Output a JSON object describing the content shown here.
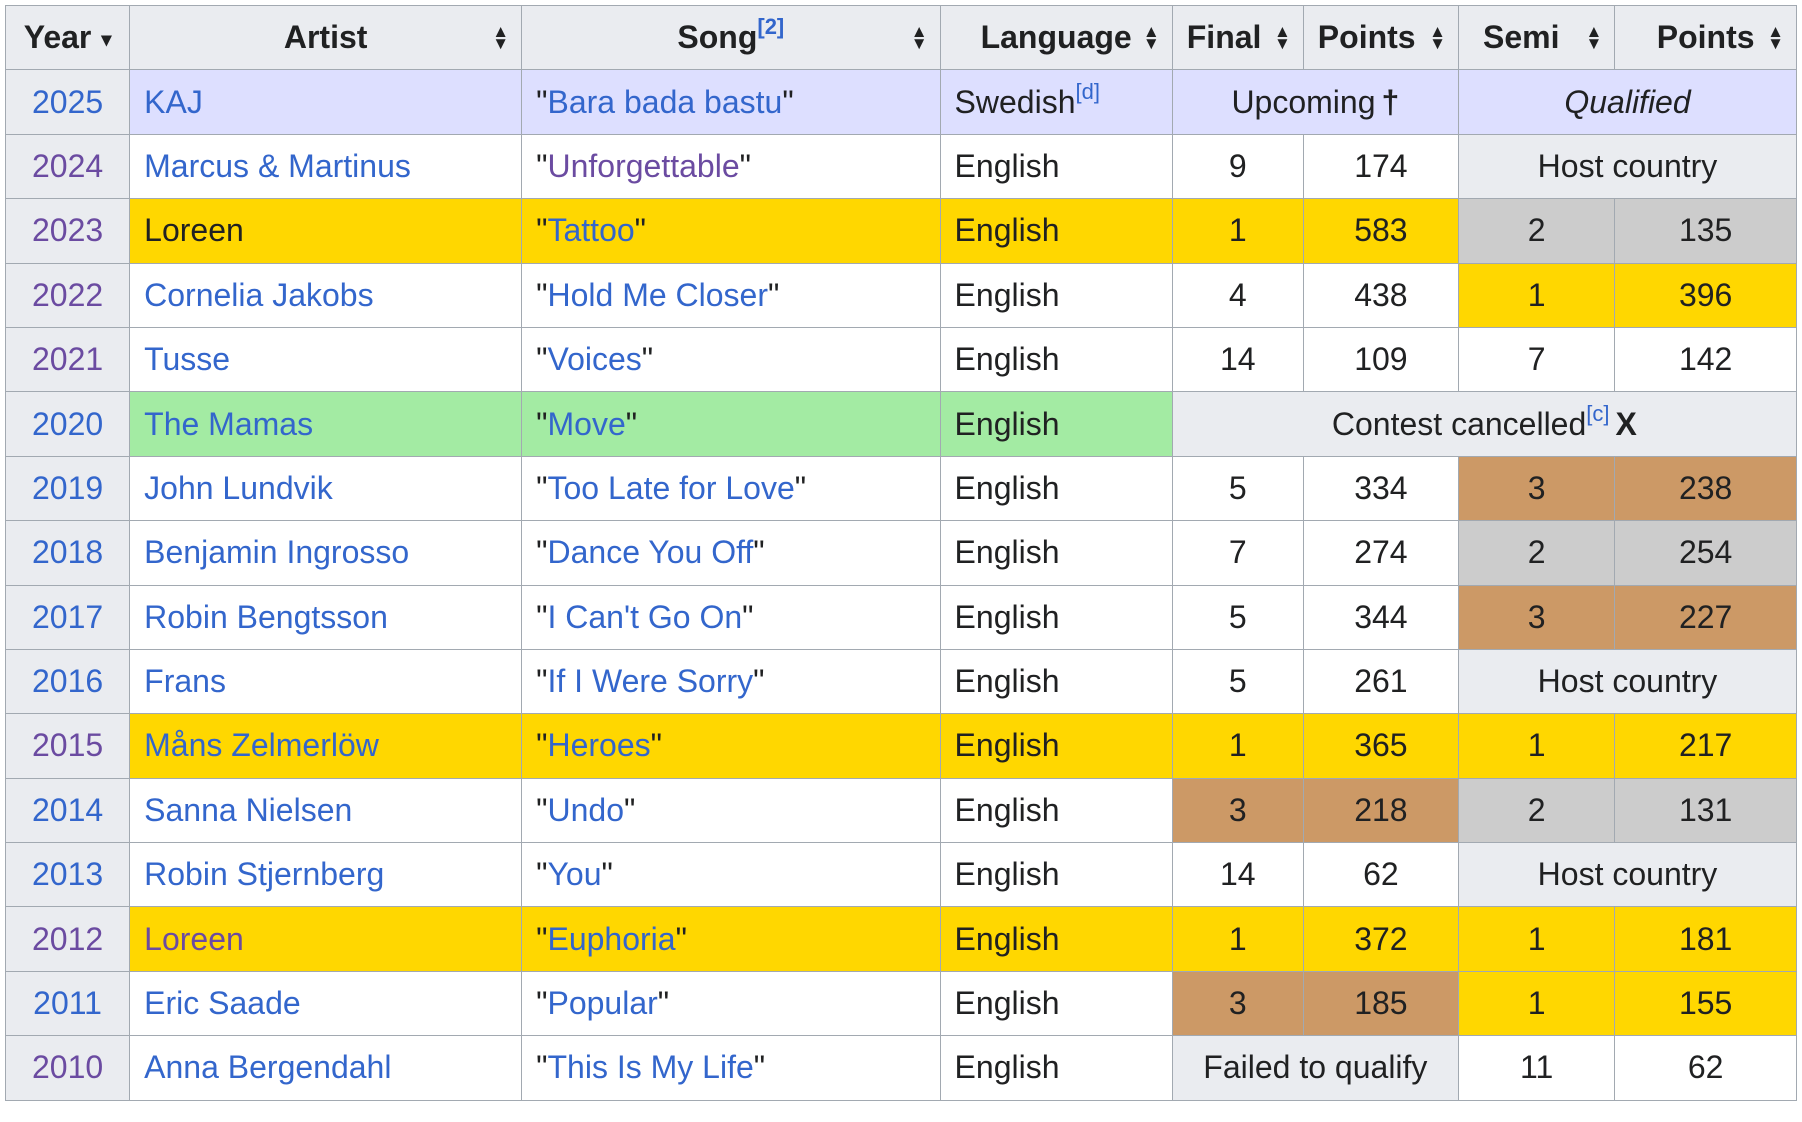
{
  "headers": {
    "year": "Year",
    "artist": "Artist",
    "song": "Song",
    "song_ref": "[2]",
    "language": "Language",
    "final": "Final",
    "points_final": "Points",
    "semi": "Semi",
    "points_semi": "Points"
  },
  "icons": {
    "sort_down": "▾",
    "sort_up": "▲",
    "sort_dn": "▼",
    "dagger": "†",
    "cross": "X"
  },
  "rows": {
    "r2025": {
      "year": "2025",
      "artist": "KAJ",
      "song": "\"Bara bada bastu\"",
      "song_pre": "\"",
      "song_link": "Bara bada bastu",
      "song_post": "\"",
      "language": "Swedish",
      "lang_ref": "[d]",
      "final_span": "Upcoming",
      "semi_span": "Qualified"
    },
    "r2024": {
      "year": "2024",
      "artist": "Marcus & Martinus",
      "song_pre": "\"",
      "song_link": "Unforgettable",
      "song_post": "\"",
      "language": "English",
      "final": "9",
      "points": "174",
      "semi_span": "Host country"
    },
    "r2023": {
      "year": "2023",
      "artist": "Loreen",
      "song_pre": "\"",
      "song_link": "Tattoo",
      "song_post": "\"",
      "language": "English",
      "final": "1",
      "points": "583",
      "semi": "2",
      "semi_points": "135"
    },
    "r2022": {
      "year": "2022",
      "artist": "Cornelia Jakobs",
      "song_pre": "\"",
      "song_link": "Hold Me Closer",
      "song_post": "\"",
      "language": "English",
      "final": "4",
      "points": "438",
      "semi": "1",
      "semi_points": "396"
    },
    "r2021": {
      "year": "2021",
      "artist": "Tusse",
      "song_pre": "\"",
      "song_link": "Voices",
      "song_post": "\"",
      "language": "English",
      "final": "14",
      "points": "109",
      "semi": "7",
      "semi_points": "142"
    },
    "r2020": {
      "year": "2020",
      "artist": "The Mamas",
      "song_pre": "\"",
      "song_link": "Move",
      "song_post": "\"",
      "language": "English",
      "cancel": "Contest cancelled",
      "cancel_ref": "[c]"
    },
    "r2019": {
      "year": "2019",
      "artist": "John Lundvik",
      "song_pre": "\"",
      "song_link": "Too Late for Love",
      "song_post": "\"",
      "language": "English",
      "final": "5",
      "points": "334",
      "semi": "3",
      "semi_points": "238"
    },
    "r2018": {
      "year": "2018",
      "artist": "Benjamin Ingrosso",
      "song_pre": "\"",
      "song_link": "Dance You Off",
      "song_post": "\"",
      "language": "English",
      "final": "7",
      "points": "274",
      "semi": "2",
      "semi_points": "254"
    },
    "r2017": {
      "year": "2017",
      "artist": "Robin Bengtsson",
      "song_pre": "\"",
      "song_link": "I Can't Go On",
      "song_post": "\"",
      "language": "English",
      "final": "5",
      "points": "344",
      "semi": "3",
      "semi_points": "227"
    },
    "r2016": {
      "year": "2016",
      "artist": "Frans",
      "song_pre": "\"",
      "song_link": "If I Were Sorry",
      "song_post": "\"",
      "language": "English",
      "final": "5",
      "points": "261",
      "semi_span": "Host country"
    },
    "r2015": {
      "year": "2015",
      "artist": "Måns Zelmerlöw",
      "song_pre": "\"",
      "song_link": "Heroes",
      "song_post": "\"",
      "language": "English",
      "final": "1",
      "points": "365",
      "semi": "1",
      "semi_points": "217"
    },
    "r2014": {
      "year": "2014",
      "artist": "Sanna Nielsen",
      "song_pre": "\"",
      "song_link": "Undo",
      "song_post": "\"",
      "language": "English",
      "final": "3",
      "points": "218",
      "semi": "2",
      "semi_points": "131"
    },
    "r2013": {
      "year": "2013",
      "artist": "Robin Stjernberg",
      "song_pre": "\"",
      "song_link": "You",
      "song_post": "\"",
      "language": "English",
      "final": "14",
      "points": "62",
      "semi_span": "Host country"
    },
    "r2012": {
      "year": "2012",
      "artist": "Loreen",
      "song_pre": "\"",
      "song_link": "Euphoria",
      "song_post": "\"",
      "language": "English",
      "final": "1",
      "points": "372",
      "semi": "1",
      "semi_points": "181"
    },
    "r2011": {
      "year": "2011",
      "artist": "Eric Saade",
      "song_pre": "\"",
      "song_link": "Popular",
      "song_post": "\"",
      "language": "English",
      "final": "3",
      "points": "185",
      "semi": "1",
      "semi_points": "155"
    },
    "r2010": {
      "year": "2010",
      "artist": "Anna Bergendahl",
      "song_pre": "\"",
      "song_link": "This Is My Life",
      "song_post": "\"",
      "language": "English",
      "final_span": "Failed to qualify",
      "semi": "11",
      "semi_points": "62"
    }
  }
}
